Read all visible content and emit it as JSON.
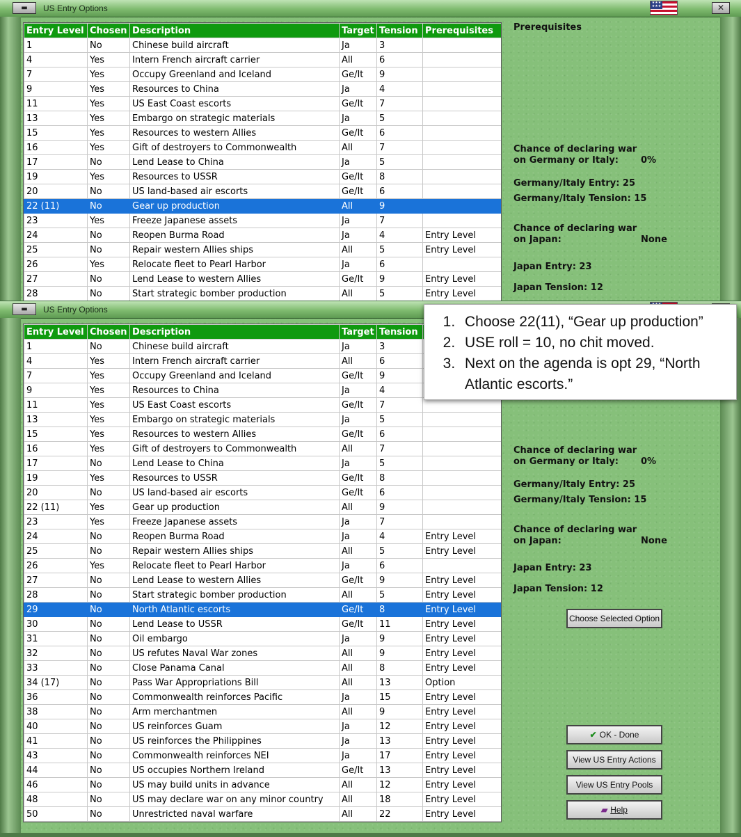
{
  "window_title": "US Entry Options",
  "columns": [
    "Entry Level",
    "Chosen",
    "Description",
    "Target",
    "Tension",
    "Prerequisites"
  ],
  "top_rows": [
    [
      "1",
      "No",
      "Chinese build aircraft",
      "Ja",
      "3",
      ""
    ],
    [
      "4",
      "Yes",
      "Intern French aircraft carrier",
      "All",
      "6",
      ""
    ],
    [
      "7",
      "Yes",
      "Occupy Greenland and Iceland",
      "Ge/It",
      "9",
      ""
    ],
    [
      "9",
      "Yes",
      "Resources to China",
      "Ja",
      "4",
      ""
    ],
    [
      "11",
      "Yes",
      "US East Coast escorts",
      "Ge/It",
      "7",
      ""
    ],
    [
      "13",
      "Yes",
      "Embargo on strategic materials",
      "Ja",
      "5",
      ""
    ],
    [
      "15",
      "Yes",
      "Resources to western Allies",
      "Ge/It",
      "6",
      ""
    ],
    [
      "16",
      "Yes",
      "Gift of destroyers to Commonwealth",
      "All",
      "7",
      ""
    ],
    [
      "17",
      "No",
      "Lend Lease to China",
      "Ja",
      "5",
      ""
    ],
    [
      "19",
      "Yes",
      "Resources to USSR",
      "Ge/It",
      "8",
      ""
    ],
    [
      "20",
      "No",
      "US land-based air escorts",
      "Ge/It",
      "6",
      ""
    ],
    [
      "22 (11)",
      "No",
      "Gear up production",
      "All",
      "9",
      ""
    ],
    [
      "23",
      "Yes",
      "Freeze Japanese assets",
      "Ja",
      "7",
      ""
    ],
    [
      "24",
      "No",
      "Reopen Burma Road",
      "Ja",
      "4",
      "Entry Level"
    ],
    [
      "25",
      "No",
      "Repair western Allies ships",
      "All",
      "5",
      "Entry Level"
    ],
    [
      "26",
      "Yes",
      "Relocate fleet to Pearl Harbor",
      "Ja",
      "6",
      ""
    ],
    [
      "27",
      "No",
      "Lend Lease to western Allies",
      "Ge/It",
      "9",
      "Entry Level"
    ],
    [
      "28",
      "No",
      "Start strategic bomber production",
      "All",
      "5",
      "Entry Level"
    ]
  ],
  "top_selected": 11,
  "bottom_rows": [
    [
      "1",
      "No",
      "Chinese build aircraft",
      "Ja",
      "3",
      ""
    ],
    [
      "4",
      "Yes",
      "Intern French aircraft carrier",
      "All",
      "6",
      ""
    ],
    [
      "7",
      "Yes",
      "Occupy Greenland and Iceland",
      "Ge/It",
      "9",
      ""
    ],
    [
      "9",
      "Yes",
      "Resources to China",
      "Ja",
      "4",
      ""
    ],
    [
      "11",
      "Yes",
      "US East Coast escorts",
      "Ge/It",
      "7",
      ""
    ],
    [
      "13",
      "Yes",
      "Embargo on strategic materials",
      "Ja",
      "5",
      ""
    ],
    [
      "15",
      "Yes",
      "Resources to western Allies",
      "Ge/It",
      "6",
      ""
    ],
    [
      "16",
      "Yes",
      "Gift of destroyers to Commonwealth",
      "All",
      "7",
      ""
    ],
    [
      "17",
      "No",
      "Lend Lease to China",
      "Ja",
      "5",
      ""
    ],
    [
      "19",
      "Yes",
      "Resources to USSR",
      "Ge/It",
      "8",
      ""
    ],
    [
      "20",
      "No",
      "US land-based air escorts",
      "Ge/It",
      "6",
      ""
    ],
    [
      "22 (11)",
      "Yes",
      "Gear up production",
      "All",
      "9",
      ""
    ],
    [
      "23",
      "Yes",
      "Freeze Japanese assets",
      "Ja",
      "7",
      ""
    ],
    [
      "24",
      "No",
      "Reopen Burma Road",
      "Ja",
      "4",
      "Entry Level"
    ],
    [
      "25",
      "No",
      "Repair western Allies ships",
      "All",
      "5",
      "Entry Level"
    ],
    [
      "26",
      "Yes",
      "Relocate fleet to Pearl Harbor",
      "Ja",
      "6",
      ""
    ],
    [
      "27",
      "No",
      "Lend Lease to western Allies",
      "Ge/It",
      "9",
      "Entry Level"
    ],
    [
      "28",
      "No",
      "Start strategic bomber production",
      "All",
      "5",
      "Entry Level"
    ],
    [
      "29",
      "No",
      "North Atlantic escorts",
      "Ge/It",
      "8",
      "Entry Level"
    ],
    [
      "30",
      "No",
      "Lend Lease to USSR",
      "Ge/It",
      "11",
      "Entry Level"
    ],
    [
      "31",
      "No",
      "Oil embargo",
      "Ja",
      "9",
      "Entry Level"
    ],
    [
      "32",
      "No",
      "US refutes Naval War zones",
      "All",
      "9",
      "Entry Level"
    ],
    [
      "33",
      "No",
      "Close Panama Canal",
      "All",
      "8",
      "Entry Level"
    ],
    [
      "34 (17)",
      "No",
      "Pass War Appropriations Bill",
      "All",
      "13",
      "Option"
    ],
    [
      "36",
      "No",
      "Commonwealth reinforces Pacific",
      "Ja",
      "15",
      "Entry Level"
    ],
    [
      "38",
      "No",
      "Arm merchantmen",
      "All",
      "9",
      "Entry Level"
    ],
    [
      "40",
      "No",
      "US reinforces Guam",
      "Ja",
      "12",
      "Entry Level"
    ],
    [
      "41",
      "No",
      "US reinforces the Philippines",
      "Ja",
      "13",
      "Entry Level"
    ],
    [
      "43",
      "No",
      "Commonwealth reinforces NEI",
      "Ja",
      "17",
      "Entry Level"
    ],
    [
      "44",
      "No",
      "US occupies Northern Ireland",
      "Ge/It",
      "13",
      "Entry Level"
    ],
    [
      "46",
      "No",
      "US may build units in advance",
      "All",
      "12",
      "Entry Level"
    ],
    [
      "48",
      "No",
      "US may declare war on any minor country",
      "All",
      "18",
      "Entry Level"
    ],
    [
      "50",
      "No",
      "Unrestricted naval warfare",
      "All",
      "22",
      "Entry Level"
    ]
  ],
  "bottom_selected": 18,
  "panel": {
    "prereq_title": "Prerequisites",
    "ger_chance_line1": "Chance of declaring war",
    "ger_chance_line2": "on Germany or Italy:",
    "ger_chance_value": "0%",
    "ger_entry": "Germany/Italy Entry: 25",
    "ger_tension": "Germany/Italy Tension: 15",
    "jap_chance_line1": "Chance of declaring war",
    "jap_chance_line2": "on Japan:",
    "jap_chance_value": "None",
    "jap_entry": "Japan Entry: 23",
    "jap_tension": "Japan Tension: 12"
  },
  "buttons": {
    "choose": "Choose Selected Option",
    "ok": "OK - Done",
    "view_actions": "View US Entry Actions",
    "view_pools": "View US Entry Pools",
    "help": "Help"
  },
  "annotation": [
    "Choose 22(11), “Gear up production”",
    "USE roll = 10, no chit moved.",
    "Next on the agenda is opt 29, “North Atlantic escorts.”"
  ],
  "icons": {
    "minimize": "minimize-icon",
    "close": "close-icon",
    "flag": "us-flag-icon",
    "check": "check-icon",
    "help": "help-book-icon"
  },
  "colors": {
    "header_bg": "#0f9a0f",
    "selected_row": "#1a73d9",
    "window_bg": "#86c07a"
  }
}
